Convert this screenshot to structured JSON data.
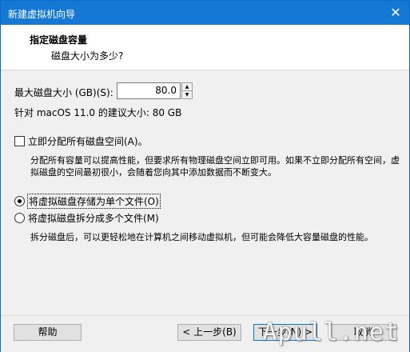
{
  "window": {
    "title": "新建虚拟机向导",
    "close_glyph": "✕"
  },
  "header": {
    "title": "指定磁盘容量",
    "subtitle": "磁盘大小为多少?"
  },
  "disk": {
    "label": "最大磁盘大小 (GB)(S):",
    "value": "80.0",
    "spin_up": "▲",
    "spin_down": "▼",
    "recommendation": "针对 macOS 11.0 的建议大小: 80 GB"
  },
  "allocate": {
    "label": "立即分配所有磁盘空间(A)。",
    "checked": false,
    "description": "分配所有容量可以提高性能，但要求所有物理磁盘空间立即可用。如果不立即分配所有空间，虚拟磁盘的空间最初很小，会随着您向其中添加数据而不断变大。"
  },
  "storage_options": [
    {
      "label": "将虚拟磁盘存储为单个文件(O)",
      "selected": true
    },
    {
      "label": "将虚拟磁盘拆分成多个文件(M)",
      "selected": false
    }
  ],
  "split_description": "拆分磁盘后，可以更轻松地在计算机之间移动虚拟机，但可能会降低大容量磁盘的性能。",
  "buttons": {
    "help": "帮助",
    "back": "< 上一步(B)",
    "next": "下一步(N) >",
    "cancel": "取消"
  },
  "watermark": "Apull.net",
  "colors": {
    "titlebar": "#1478d4",
    "accent": "#0078d7"
  }
}
